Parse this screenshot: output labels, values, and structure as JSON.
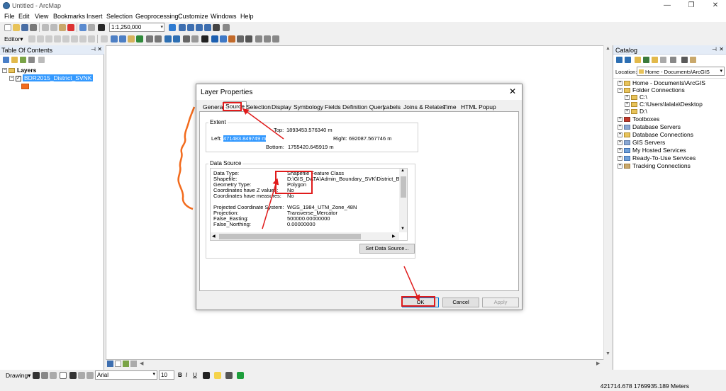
{
  "window": {
    "title": "Untitled - ArcMap",
    "minimize": "—",
    "restore": "❐",
    "close": "✕"
  },
  "menu": [
    "File",
    "Edit",
    "View",
    "Bookmarks",
    "Insert",
    "Selection",
    "Geoprocessing",
    "Customize",
    "Windows",
    "Help"
  ],
  "toolbar": {
    "scale": "1:1,250,000",
    "editor_label": "Editor▾"
  },
  "toc": {
    "title": "Table Of Contents",
    "root": "Layers",
    "layer": "BDR2015_District_SVNK"
  },
  "catalog": {
    "title": "Catalog",
    "location_label": "Location:",
    "location_value": "Home - Documents\\ArcGIS",
    "items": [
      {
        "label": "Home - Documents\\ArcGIS",
        "indent": 0,
        "expander": "+"
      },
      {
        "label": "Folder Connections",
        "indent": 0,
        "expander": "−"
      },
      {
        "label": "C:\\",
        "indent": 1,
        "expander": "+"
      },
      {
        "label": "C:\\Users\\lalala\\Desktop",
        "indent": 1,
        "expander": "+"
      },
      {
        "label": "D:\\",
        "indent": 1,
        "expander": "+"
      },
      {
        "label": "Toolboxes",
        "indent": 0,
        "expander": "+"
      },
      {
        "label": "Database Servers",
        "indent": 0,
        "expander": "+"
      },
      {
        "label": "Database Connections",
        "indent": 0,
        "expander": "+"
      },
      {
        "label": "GIS Servers",
        "indent": 0,
        "expander": "+"
      },
      {
        "label": "My Hosted Services",
        "indent": 0,
        "expander": "+"
      },
      {
        "label": "Ready-To-Use Services",
        "indent": 0,
        "expander": "+"
      },
      {
        "label": "Tracking Connections",
        "indent": 0,
        "expander": "+"
      }
    ]
  },
  "dialog": {
    "title": "Layer Properties",
    "tabs": [
      "General",
      "Source",
      "Selection",
      "Display",
      "Symbology",
      "Fields",
      "Definition Query",
      "Labels",
      "Joins & Relates",
      "Time",
      "HTML Popup"
    ],
    "active_tab": "Source",
    "extent": {
      "group": "Extent",
      "top_label": "Top:",
      "top": "1893453.576340 m",
      "left_label": "Left:",
      "left": "471483.849749 m",
      "right_label": "Right:",
      "right": "692087.567746 m",
      "bottom_label": "Bottom:",
      "bottom": "1755420.645919 m"
    },
    "data_source": {
      "group": "Data Source",
      "rows": [
        {
          "k": "Data Type:",
          "v": "Shapefile Feature Class"
        },
        {
          "k": "Shapefile:",
          "v": "D:\\GIS_DATA\\Admin_Boundary_SVK\\District_BND\\BDR"
        },
        {
          "k": "Geometry Type:",
          "v": "Polygon"
        },
        {
          "k": "Coordinates have Z values:",
          "v": "No"
        },
        {
          "k": "Coordinates have measures:",
          "v": "No"
        },
        {
          "k": "",
          "v": ""
        },
        {
          "k": "Projected Coordinate System:",
          "v": "WGS_1984_UTM_Zone_48N"
        },
        {
          "k": "Projection:",
          "v": "Transverse_Mercator"
        },
        {
          "k": "False_Easting:",
          "v": "500000.00000000"
        },
        {
          "k": "False_Northing:",
          "v": "0.00000000"
        }
      ],
      "set_button": "Set Data Source..."
    },
    "buttons": {
      "ok": "OK",
      "cancel": "Cancel",
      "apply": "Apply"
    }
  },
  "drawing": {
    "label": "Drawing▾",
    "font": "Arial",
    "size": "10"
  },
  "status": {
    "coords": "421714.678  1769935.189 Meters"
  },
  "colors": {
    "annotation_red": "#e01b1b",
    "layer_orange": "#f26b1d",
    "selection_blue": "#3399ff"
  }
}
